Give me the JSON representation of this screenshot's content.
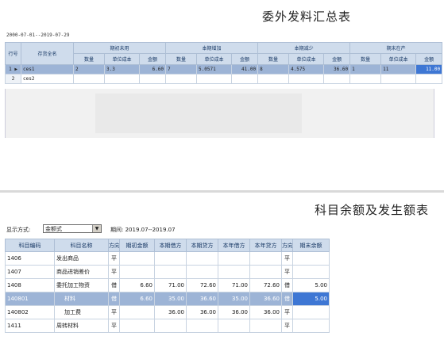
{
  "top": {
    "title": "委外发料汇总表",
    "date_range": "2000-07-01--2019-07-29",
    "group_headers": [
      "期初未用",
      "本期增加",
      "本期减少",
      "期末在产"
    ],
    "col_rowno": "行号",
    "col_name": "存货全名",
    "sub_headers": [
      "数量",
      "单位成本",
      "金额"
    ],
    "rows": [
      {
        "no": "1",
        "name": "ces1",
        "cells": [
          "2",
          "3.3",
          "6.60",
          "7",
          "5.0571",
          "41.00",
          "8",
          "4.575",
          "36.60",
          "1",
          "11",
          "11.00"
        ]
      },
      {
        "no": "2",
        "name": "ces2",
        "cells": [
          "",
          "",
          "",
          "",
          "",
          "",
          "",
          "",
          "",
          "",
          "",
          ""
        ]
      }
    ]
  },
  "bottom": {
    "title": "科目余额及发生额表",
    "display_label": "显示方式:",
    "display_value": "金额式",
    "period": "期间: 2019.07--2019.07",
    "headers": [
      "科目编码",
      "科目名称",
      "方向",
      "期初金额",
      "本期借方",
      "本期贷方",
      "本年借方",
      "本年贷方",
      "方向",
      "期末余额"
    ],
    "rows": [
      {
        "code": "1406",
        "name": "发出商品",
        "dir": "平",
        "open": "",
        "dr": "",
        "cr": "",
        "ydr": "",
        "ycr": "",
        "dir2": "平",
        "close": ""
      },
      {
        "code": "1407",
        "name": "商品进销差价",
        "dir": "平",
        "open": "",
        "dr": "",
        "cr": "",
        "ydr": "",
        "ycr": "",
        "dir2": "平",
        "close": ""
      },
      {
        "code": "1408",
        "name": "委托加工物资",
        "dir": "借",
        "open": "6.60",
        "dr": "71.00",
        "cr": "72.60",
        "ydr": "71.00",
        "ycr": "72.60",
        "dir2": "借",
        "close": "5.00"
      },
      {
        "code": "140801",
        "name": "材料",
        "dir": "借",
        "open": "6.60",
        "dr": "35.00",
        "cr": "36.60",
        "ydr": "35.00",
        "ycr": "36.60",
        "dir2": "借",
        "close": "5.00"
      },
      {
        "code": "140802",
        "name": "加工费",
        "dir": "平",
        "open": "",
        "dr": "36.00",
        "cr": "36.00",
        "ydr": "36.00",
        "ycr": "36.00",
        "dir2": "平",
        "close": ""
      },
      {
        "code": "1411",
        "name": "周转材料",
        "dir": "平",
        "open": "",
        "dr": "",
        "cr": "",
        "ydr": "",
        "ycr": "",
        "dir2": "平",
        "close": ""
      }
    ]
  },
  "colors": {
    "header_bg": "#cfdcec",
    "selected_row": "#9db4d6",
    "selected_cell": "#3e77d4"
  }
}
